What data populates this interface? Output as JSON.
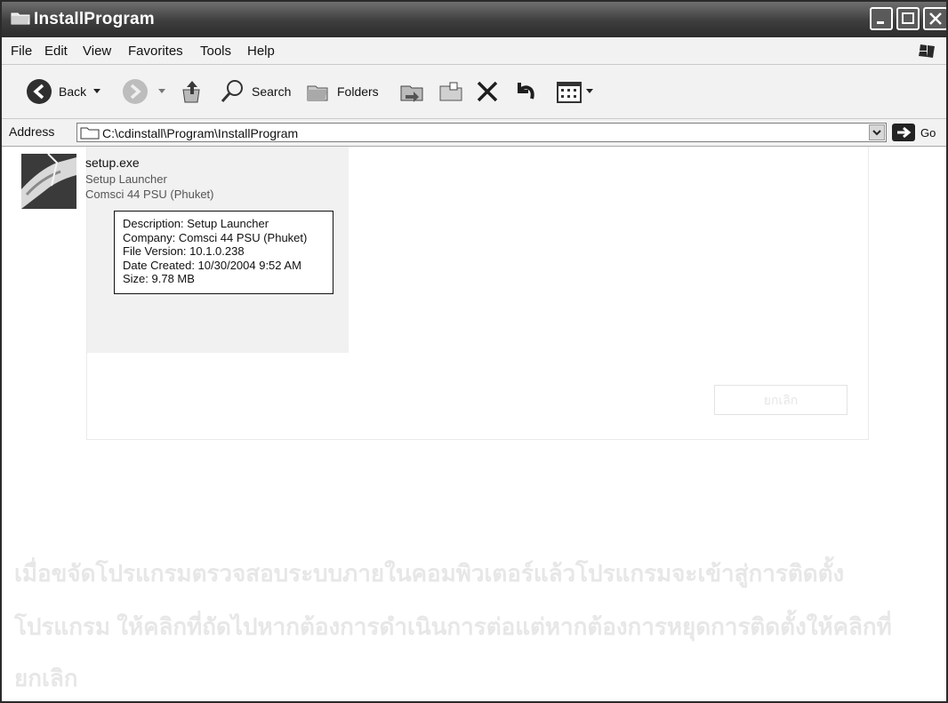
{
  "window": {
    "title": "InstallProgram"
  },
  "menu": [
    "File",
    "Edit",
    "View",
    "Favorites",
    "Tools",
    "Help"
  ],
  "toolbar": {
    "back": "Back",
    "search": "Search",
    "folders": "Folders"
  },
  "address": {
    "label": "Address",
    "path": "C:\\cdinstall\\Program\\InstallProgram",
    "go": "Go"
  },
  "file": {
    "name": "setup.exe",
    "description": "Setup Launcher",
    "company": "Comsci 44 PSU (Phuket)"
  },
  "tooltip": {
    "description": "Description: Setup Launcher",
    "company": "Company: Comsci 44 PSU (Phuket)",
    "version": "File Version: 10.1.0.238",
    "created": "Date Created: 10/30/2004 9:52 AM",
    "size": "Size: 9.78 MB"
  },
  "background_text": {
    "ghost_button": "ยกเลิก",
    "line1": "เมื่อขจัดโปรแกรมตรวจสอบระบบภายในคอมพิวเตอร์แล้วโปรแกรมจะเข้าสู่การติดตั้ง",
    "line2": "โปรแกรม ให้คลิกที่ถัดไปหากต้องการดำเนินการต่อแต่หากต้องการหยุดการติดตั้งให้คลิกที่",
    "line3": "ยกเลิก"
  }
}
